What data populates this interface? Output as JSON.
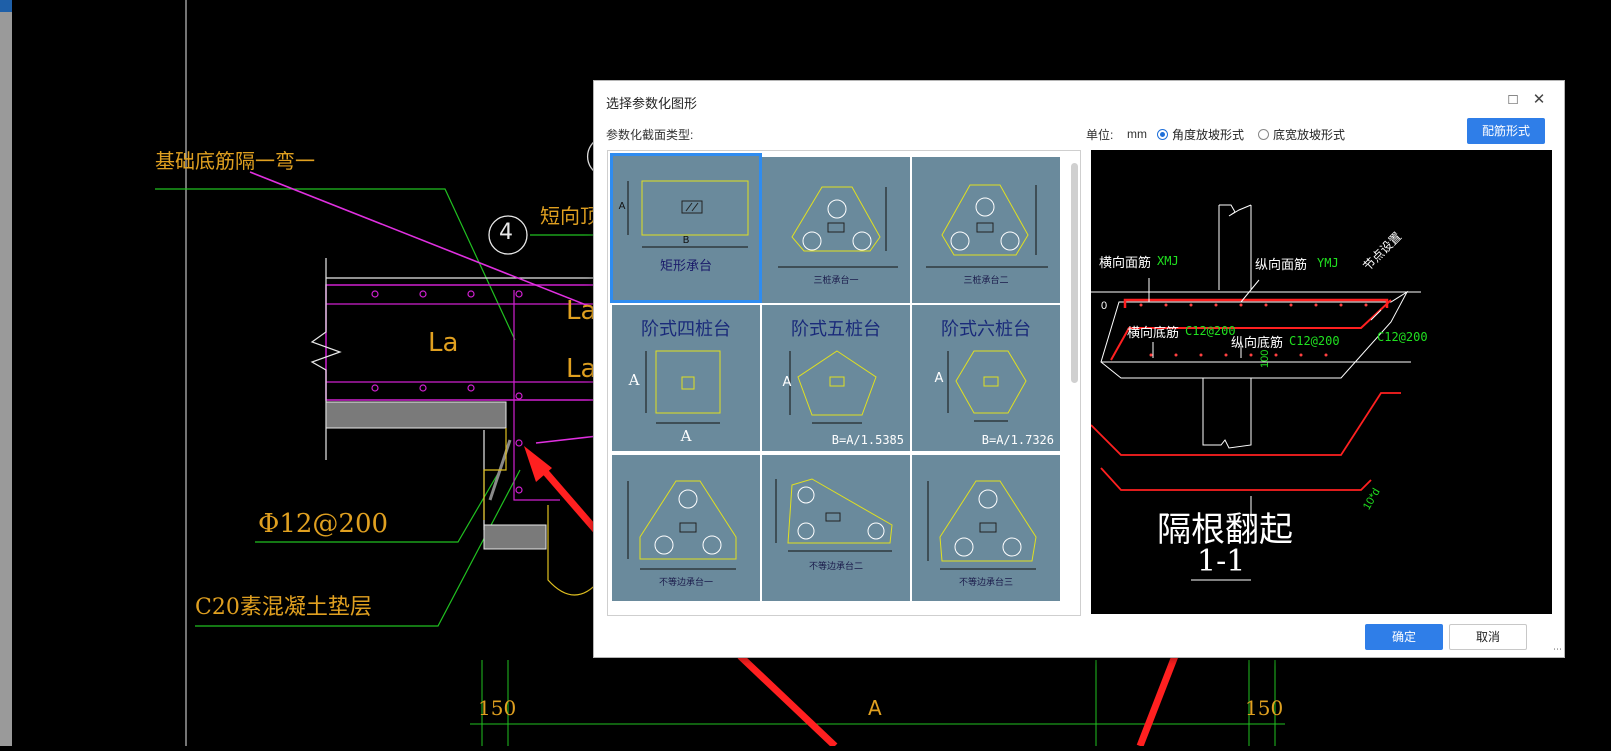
{
  "cad": {
    "labels": {
      "rebar_note": "基础底筋隔一弯一",
      "axis_4": "4",
      "short_top": "短向顶筋",
      "la_left": "La",
      "la_right_1": "La",
      "la_right_2": "La",
      "rebar_spec": "Φ12@200",
      "cushion": "C20素混凝土垫层",
      "dim_150_left": "150",
      "dim_a": "A",
      "dim_150_right": "150"
    }
  },
  "dialog": {
    "title": "选择参数化图形",
    "maximize_icon": "maximize-icon",
    "close_icon": "close-icon",
    "section_type_label": "参数化截面类型:",
    "unit_label": "单位:",
    "unit_value": "mm",
    "radio_angle": "角度放坡形式",
    "radio_width": "底宽放坡形式",
    "radio_selected": "角度放坡形式",
    "rebar_button": "配筋形式",
    "ok_button": "确定",
    "cancel_button": "取消",
    "accent_color": "#2f7ee8",
    "gallery": [
      {
        "caption": "矩形承台",
        "selected": true,
        "dims": [
          "A",
          "B"
        ]
      },
      {
        "caption": "三桩承台一",
        "selected": false,
        "dims": []
      },
      {
        "caption": "三桩承台二",
        "selected": false,
        "dims": []
      },
      {
        "caption": "阶式四桩台",
        "selected": false,
        "dims": [
          "A",
          "A"
        ]
      },
      {
        "caption": "阶式五桩台",
        "selected": false,
        "formula": "B=A/1.5385",
        "dims": [
          "A"
        ]
      },
      {
        "caption": "阶式六桩台",
        "selected": false,
        "formula": "B=A/1.7326",
        "dims": [
          "A"
        ]
      },
      {
        "caption": "不等边承台一",
        "selected": false,
        "dims": []
      },
      {
        "caption": "不等边承台二",
        "selected": false,
        "dims": []
      },
      {
        "caption": "不等边承台三",
        "selected": false,
        "dims": []
      }
    ],
    "preview": {
      "h_top": "横向面筋",
      "h_top_code": "XMJ",
      "v_top": "纵向面筋",
      "v_top_code": "YMJ",
      "h_bottom": "横向底筋",
      "h_bottom_spec": "C12@200",
      "v_bottom": "纵向底筋",
      "v_bottom_spec": "C12@200",
      "right_spec": "C12@200",
      "node_note": "节点设置",
      "zero": "0",
      "dim_100": "100",
      "dim_10d": "10*d",
      "annotation": "隔根翻起",
      "section": "1-1"
    }
  }
}
